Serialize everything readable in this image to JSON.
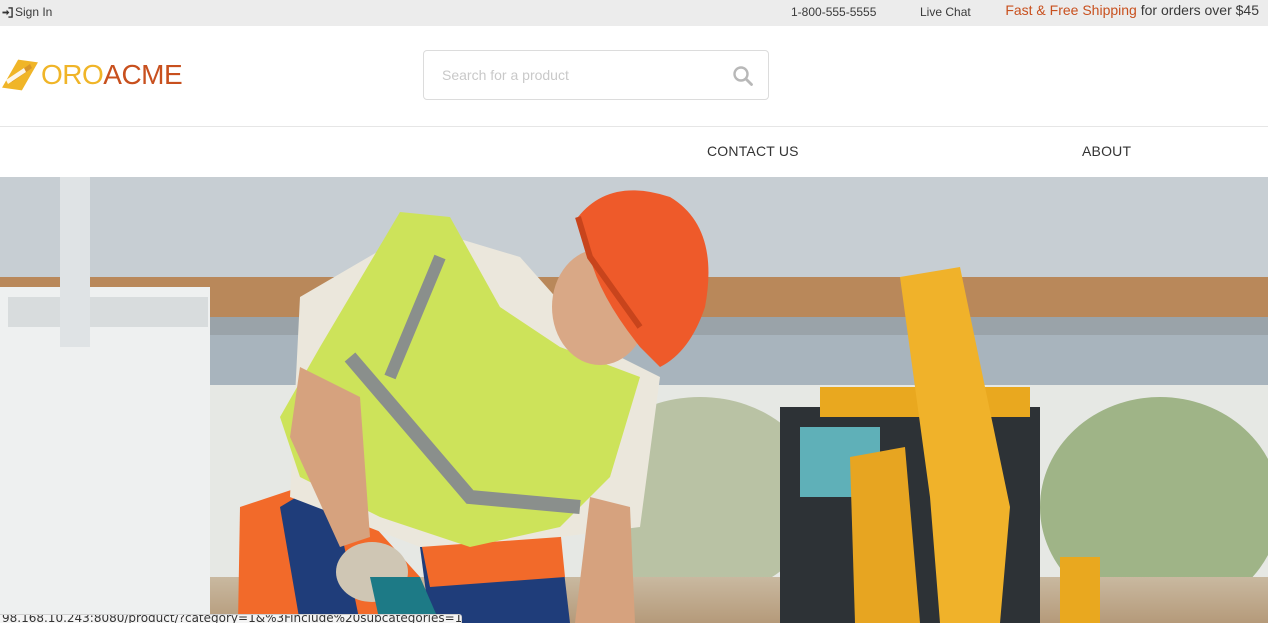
{
  "topbar": {
    "sign_in": "Sign In",
    "phone": "1-800-555-5555",
    "live_chat": "Live Chat",
    "shipping_accent": "Fast & Free Shipping",
    "shipping_rest": " for orders over $45"
  },
  "header": {
    "logo_oro": "ORO",
    "logo_acme": "ACME",
    "search_placeholder": "Search for a product"
  },
  "nav": {
    "items": [
      {
        "label": "CONTACT US"
      },
      {
        "label": "ABOUT"
      }
    ]
  },
  "hero": {
    "image_alt": "Construction worker in hard hat and safety vest using a tool near an excavator"
  },
  "status": {
    "url": "98.168.10.243:8080/product/?category=1&%3Finclude%20subcategories=1"
  },
  "colors": {
    "accent": "#c8501e",
    "logo_yellow": "#f0b528",
    "topbar_bg": "#ececec"
  },
  "icons": {
    "sign_in": "sign-in-icon",
    "search": "search-icon",
    "logo": "oroacme-logo-mark"
  }
}
